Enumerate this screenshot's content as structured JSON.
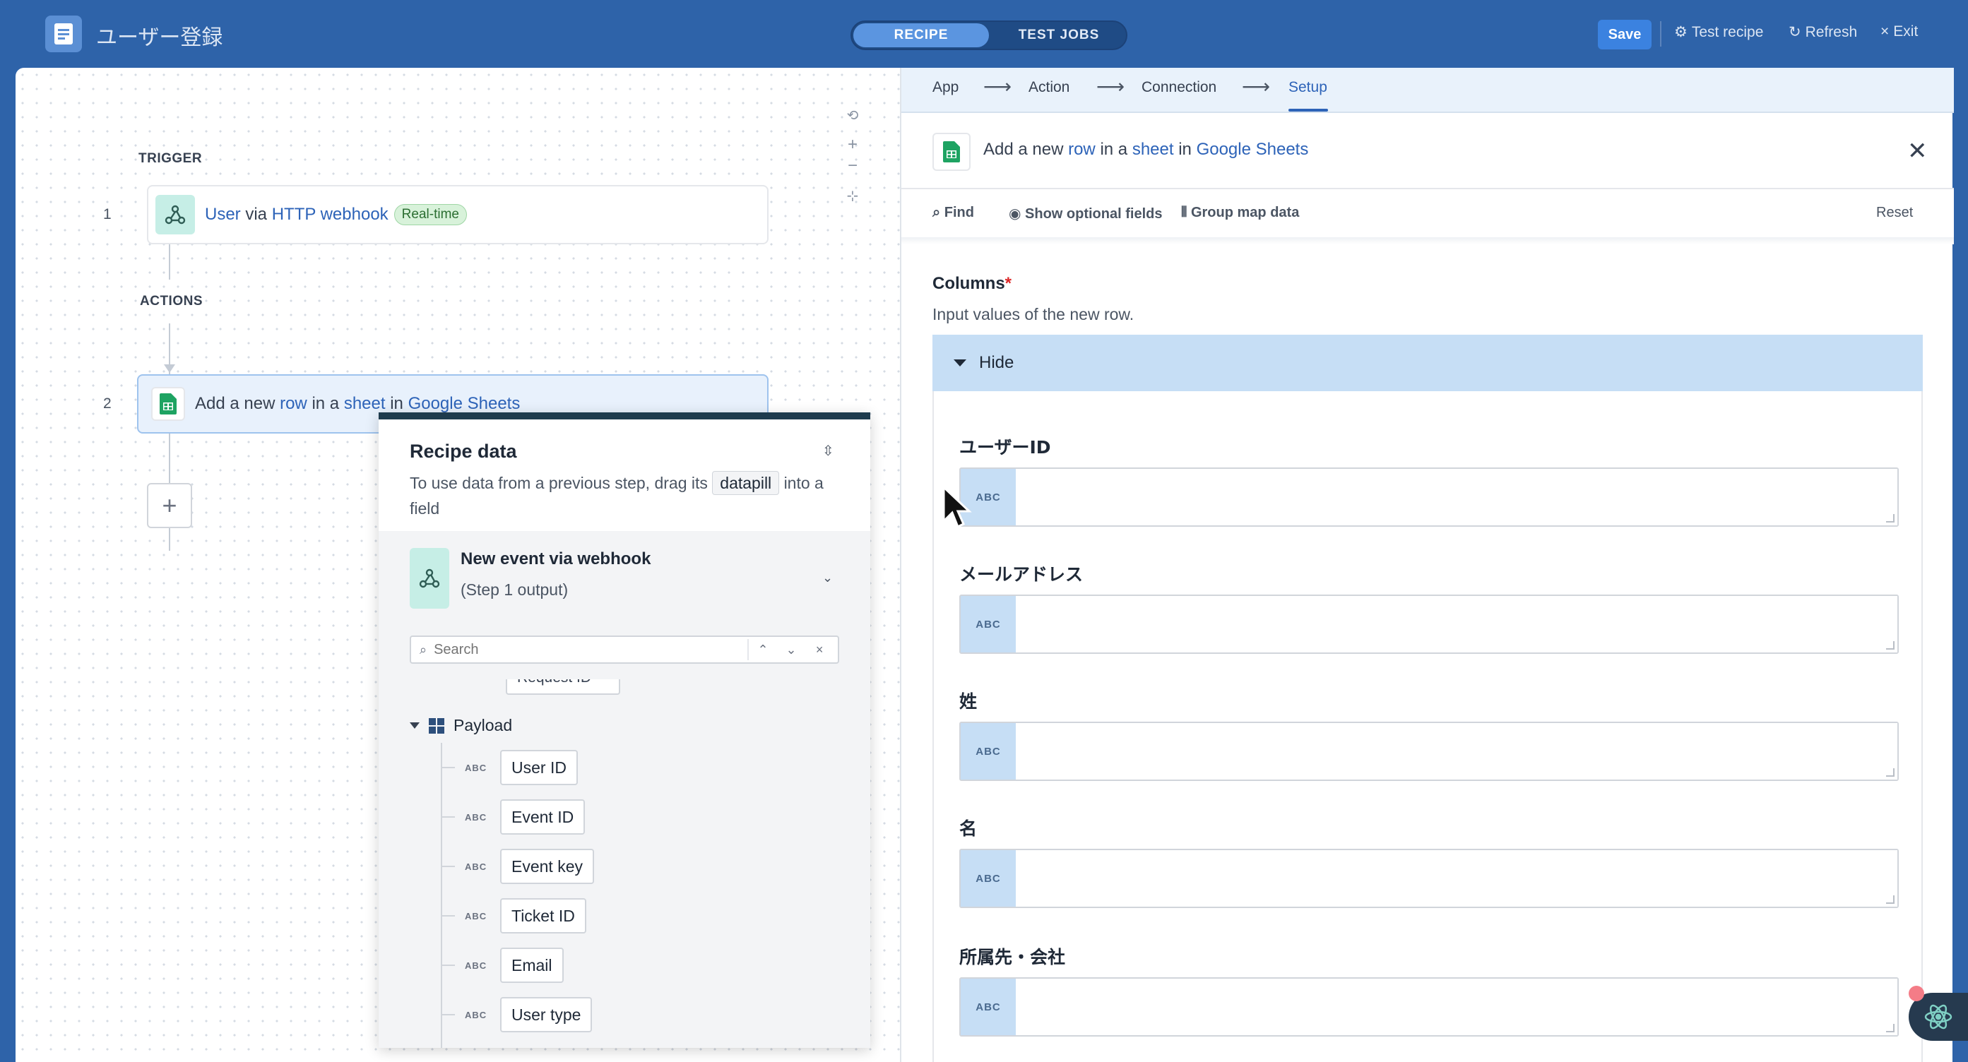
{
  "app": {
    "title": "ユーザー登録"
  },
  "mode_tabs": [
    {
      "label": "RECIPE",
      "active": true
    },
    {
      "label": "TEST JOBS",
      "active": false
    }
  ],
  "toolbar": {
    "save_label": "Save",
    "test_recipe_label": "Test recipe",
    "refresh_label": "Refresh",
    "exit_label": "Exit"
  },
  "canvas": {
    "trigger_label": "TRIGGER",
    "actions_label": "ACTIONS",
    "step1": {
      "number": "1",
      "subject": "User",
      "via": "via",
      "source": "HTTP webhook",
      "badge": "Real-time"
    },
    "step2": {
      "number": "2",
      "prefix": "Add a new",
      "obj1": "row",
      "mid1": "in a",
      "obj2": "sheet",
      "mid2": "in",
      "app": "Google Sheets"
    },
    "add_step_label": "+"
  },
  "recipe_data": {
    "title": "Recipe data",
    "desc_before": "To use data from a previous step, drag its",
    "datapill_word": "datapill",
    "desc_after": "into a field",
    "source_title": "New event via webhook",
    "source_sub": "(Step 1 output)",
    "search_placeholder": "Search",
    "partial_pill": "Request ID",
    "payload_label": "Payload",
    "type_tag": "ABC",
    "pills": [
      "User ID",
      "Event ID",
      "Event key",
      "Ticket ID",
      "Email",
      "User type"
    ]
  },
  "config": {
    "breadcrumbs": [
      {
        "label": "App"
      },
      {
        "label": "Action"
      },
      {
        "label": "Connection"
      },
      {
        "label": "Setup",
        "active": true
      }
    ],
    "breadcrumb_arrow": "⟶",
    "header": {
      "prefix": "Add a new",
      "obj1": "row",
      "mid1": "in a",
      "obj2": "sheet",
      "mid2": "in",
      "app": "Google Sheets"
    },
    "tools": {
      "find": "Find",
      "optional": "Show optional fields",
      "group": "Group map data",
      "reset": "Reset"
    },
    "columns_label": "Columns",
    "required_mark": "*",
    "columns_help": "Input values of the new row.",
    "hide_label": "Hide",
    "field_type": "ABC",
    "fields": [
      {
        "label": "ユーザーID",
        "value": ""
      },
      {
        "label": "メールアドレス",
        "value": ""
      },
      {
        "label": "姓",
        "value": ""
      },
      {
        "label": "名",
        "value": ""
      },
      {
        "label": "所属先・会社",
        "value": ""
      }
    ]
  },
  "colors": {
    "topbar": "#2e63a9",
    "accent": "#2d63b8",
    "save": "#3b82e0",
    "realtime_badge": "#d8f2da",
    "sheets_green": "#1ea362",
    "webhook_teal": "#c6eee6"
  }
}
